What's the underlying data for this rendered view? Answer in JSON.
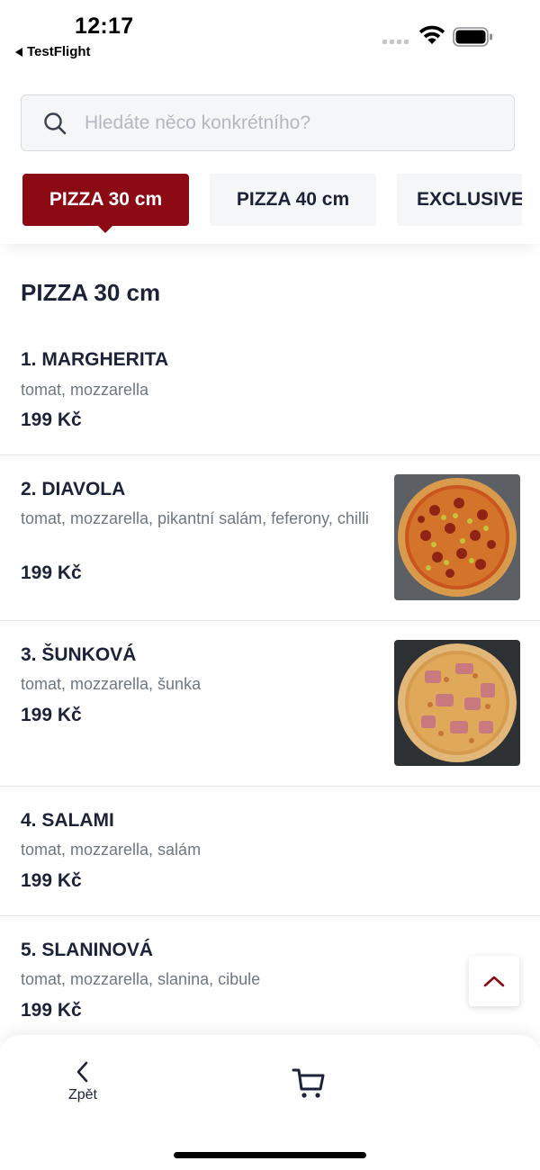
{
  "status": {
    "time": "12:17",
    "back_app": "TestFlight"
  },
  "search": {
    "placeholder": "Hledáte něco konkrétního?"
  },
  "tabs": [
    {
      "label": "PIZZA 30 cm",
      "active": true
    },
    {
      "label": "PIZZA 40 cm",
      "active": false
    },
    {
      "label": "EXCLUSIVE",
      "active": false
    }
  ],
  "section": {
    "title": "PIZZA 30 cm"
  },
  "items": [
    {
      "name": "1. MARGHERITA",
      "desc": "tomat, mozzarella",
      "price": "199 Kč",
      "has_photo": false
    },
    {
      "name": "2. DIAVOLA",
      "desc": "tomat, mozzarella, pikantní salám, feferony, chilli",
      "price": "199 Kč",
      "has_photo": true
    },
    {
      "name": "3. ŠUNKOVÁ",
      "desc": "tomat, mozzarella, šunka",
      "price": "199 Kč",
      "has_photo": true
    },
    {
      "name": "4. SALAMI",
      "desc": "tomat, mozzarella, salám",
      "price": "199 Kč",
      "has_photo": false
    },
    {
      "name": "5. SLANINOVÁ",
      "desc": "tomat, mozzarella, slanina, cibule",
      "price": "199 Kč",
      "has_photo": false
    }
  ],
  "bottom_nav": {
    "back_label": "Zpět"
  },
  "icons": {
    "search": "search-icon",
    "scroll_top": "chevron-up-icon",
    "back": "chevron-left-icon",
    "cart": "cart-icon"
  },
  "colors": {
    "accent": "#8c0a14",
    "text": "#1c2238",
    "muted": "#6f7684"
  }
}
